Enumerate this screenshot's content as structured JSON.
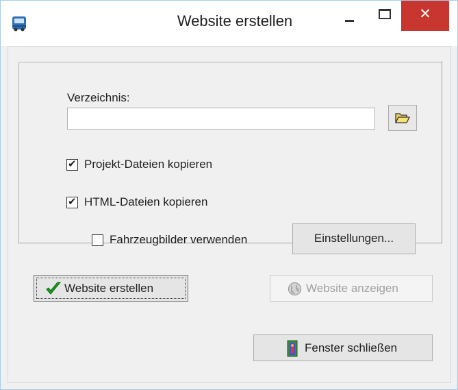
{
  "window": {
    "title": "Website erstellen",
    "app_icon": "bus-icon",
    "controls": {
      "minimize": "minimize-icon",
      "maximize": "maximize-icon",
      "close": "close-icon",
      "close_glyph": "✕"
    }
  },
  "directory": {
    "label": "Verzeichnis:",
    "value": "",
    "browse_icon": "folder-open-icon"
  },
  "options": {
    "copy_project_files": {
      "label": "Projekt-Dateien kopieren",
      "checked": true
    },
    "copy_html_files": {
      "label": "HTML-Dateien kopieren",
      "checked": true
    },
    "use_vehicle_images": {
      "label": "Fahrzeugbilder verwenden",
      "checked": false
    },
    "settings_button": "Einstellungen..."
  },
  "actions": {
    "create": {
      "label": "Website erstellen",
      "icon": "checkmark-icon",
      "enabled": true
    },
    "show": {
      "label": "Website anzeigen",
      "icon": "globe-icon",
      "enabled": false
    },
    "close": {
      "label": "Fenster schließen",
      "icon": "door-exit-icon",
      "enabled": true
    }
  },
  "colors": {
    "close_button": "#c7372f",
    "check_green": "#1f9a1f",
    "folder_yellow": "#f3d35a"
  },
  "check_glyph": "✔"
}
